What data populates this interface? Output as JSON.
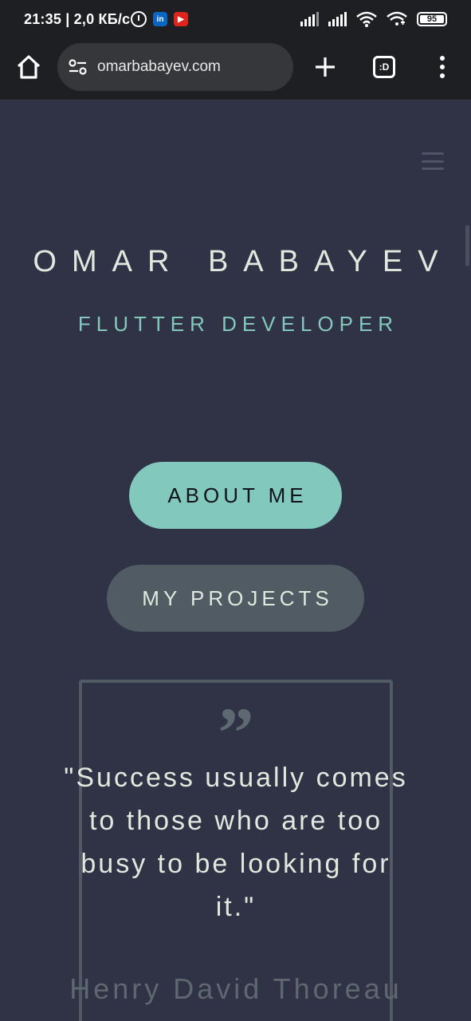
{
  "status_bar": {
    "time": "21:35",
    "speed": "| 2,0 КБ/с",
    "apps": [
      {
        "name": "linkedin-icon",
        "label": "in",
        "color": "#0a66c2"
      },
      {
        "name": "youtube-icon",
        "label": "▶",
        "color": "#e0241b"
      }
    ],
    "battery": "95"
  },
  "browser": {
    "url": "omarbabayev.com",
    "tabs_label": ":D"
  },
  "hero": {
    "name": "OMAR BABAYEV",
    "role": "FLUTTER DEVELOPER"
  },
  "buttons": {
    "about": "ABOUT ME",
    "projects": "MY PROJECTS"
  },
  "quote": {
    "mark": "”",
    "text": "\"Success usually comes to those who are too busy to be looking for it.\"",
    "author": "Henry David Thoreau"
  },
  "colors": {
    "background": "#2f3345",
    "accent": "#83c8bc",
    "heading": "#dfe9dd",
    "muted": "#515b63"
  }
}
